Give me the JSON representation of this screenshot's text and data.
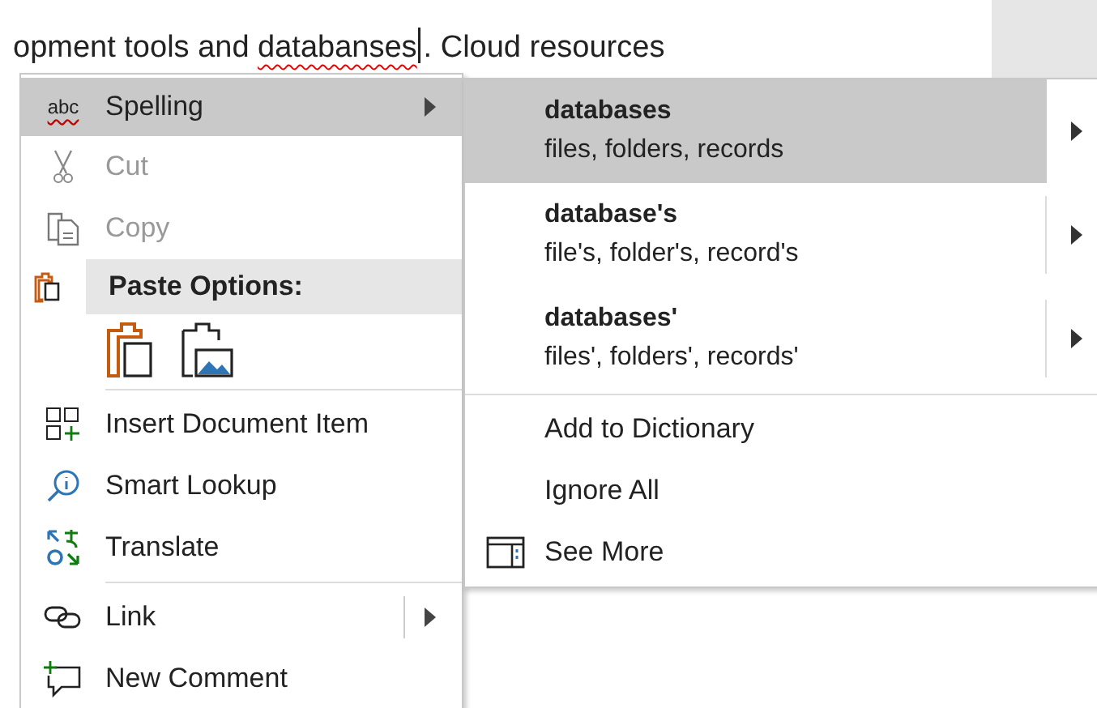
{
  "document": {
    "line_parts": [
      {
        "text": "opment tools and ",
        "misspelled": false
      },
      {
        "text": "databanses",
        "misspelled": true
      },
      {
        "text": ". Cloud resources",
        "misspelled": false
      }
    ]
  },
  "context_menu": {
    "items": [
      {
        "kind": "item",
        "icon_text": "abc",
        "label": "Spelling",
        "disabled": false,
        "selected": true,
        "submenu": true,
        "split": false
      },
      {
        "kind": "item",
        "label": "Cut",
        "disabled": true,
        "selected": false,
        "submenu": false,
        "split": false
      },
      {
        "kind": "item",
        "label": "Copy",
        "disabled": true,
        "selected": false,
        "submenu": false,
        "split": false
      },
      {
        "kind": "header",
        "label": "Paste Options:"
      },
      {
        "kind": "paste_icons"
      },
      {
        "kind": "separator"
      },
      {
        "kind": "item",
        "label": "Insert Document Item",
        "disabled": false,
        "selected": false,
        "submenu": false,
        "split": false
      },
      {
        "kind": "item",
        "label": "Smart Lookup",
        "disabled": false,
        "selected": false,
        "submenu": false,
        "split": false
      },
      {
        "kind": "item",
        "label": "Translate",
        "disabled": false,
        "selected": false,
        "submenu": false,
        "split": false
      },
      {
        "kind": "separator"
      },
      {
        "kind": "item",
        "label": "Link",
        "disabled": false,
        "selected": false,
        "submenu": true,
        "split": true
      },
      {
        "kind": "item",
        "label": "New Comment",
        "disabled": false,
        "selected": false,
        "submenu": false,
        "split": false
      }
    ]
  },
  "spelling_submenu": {
    "suggestions": [
      {
        "word": "databases",
        "synonyms": "files, folders, records",
        "selected": true
      },
      {
        "word": "database's",
        "synonyms": "file's, folder's, record's",
        "selected": false
      },
      {
        "word": "databases'",
        "synonyms": "files', folders', records'",
        "selected": false
      }
    ],
    "actions": [
      {
        "label": "Add to Dictionary",
        "icon": false
      },
      {
        "label": "Ignore All",
        "icon": false
      },
      {
        "label": "See More",
        "icon": true
      }
    ]
  }
}
